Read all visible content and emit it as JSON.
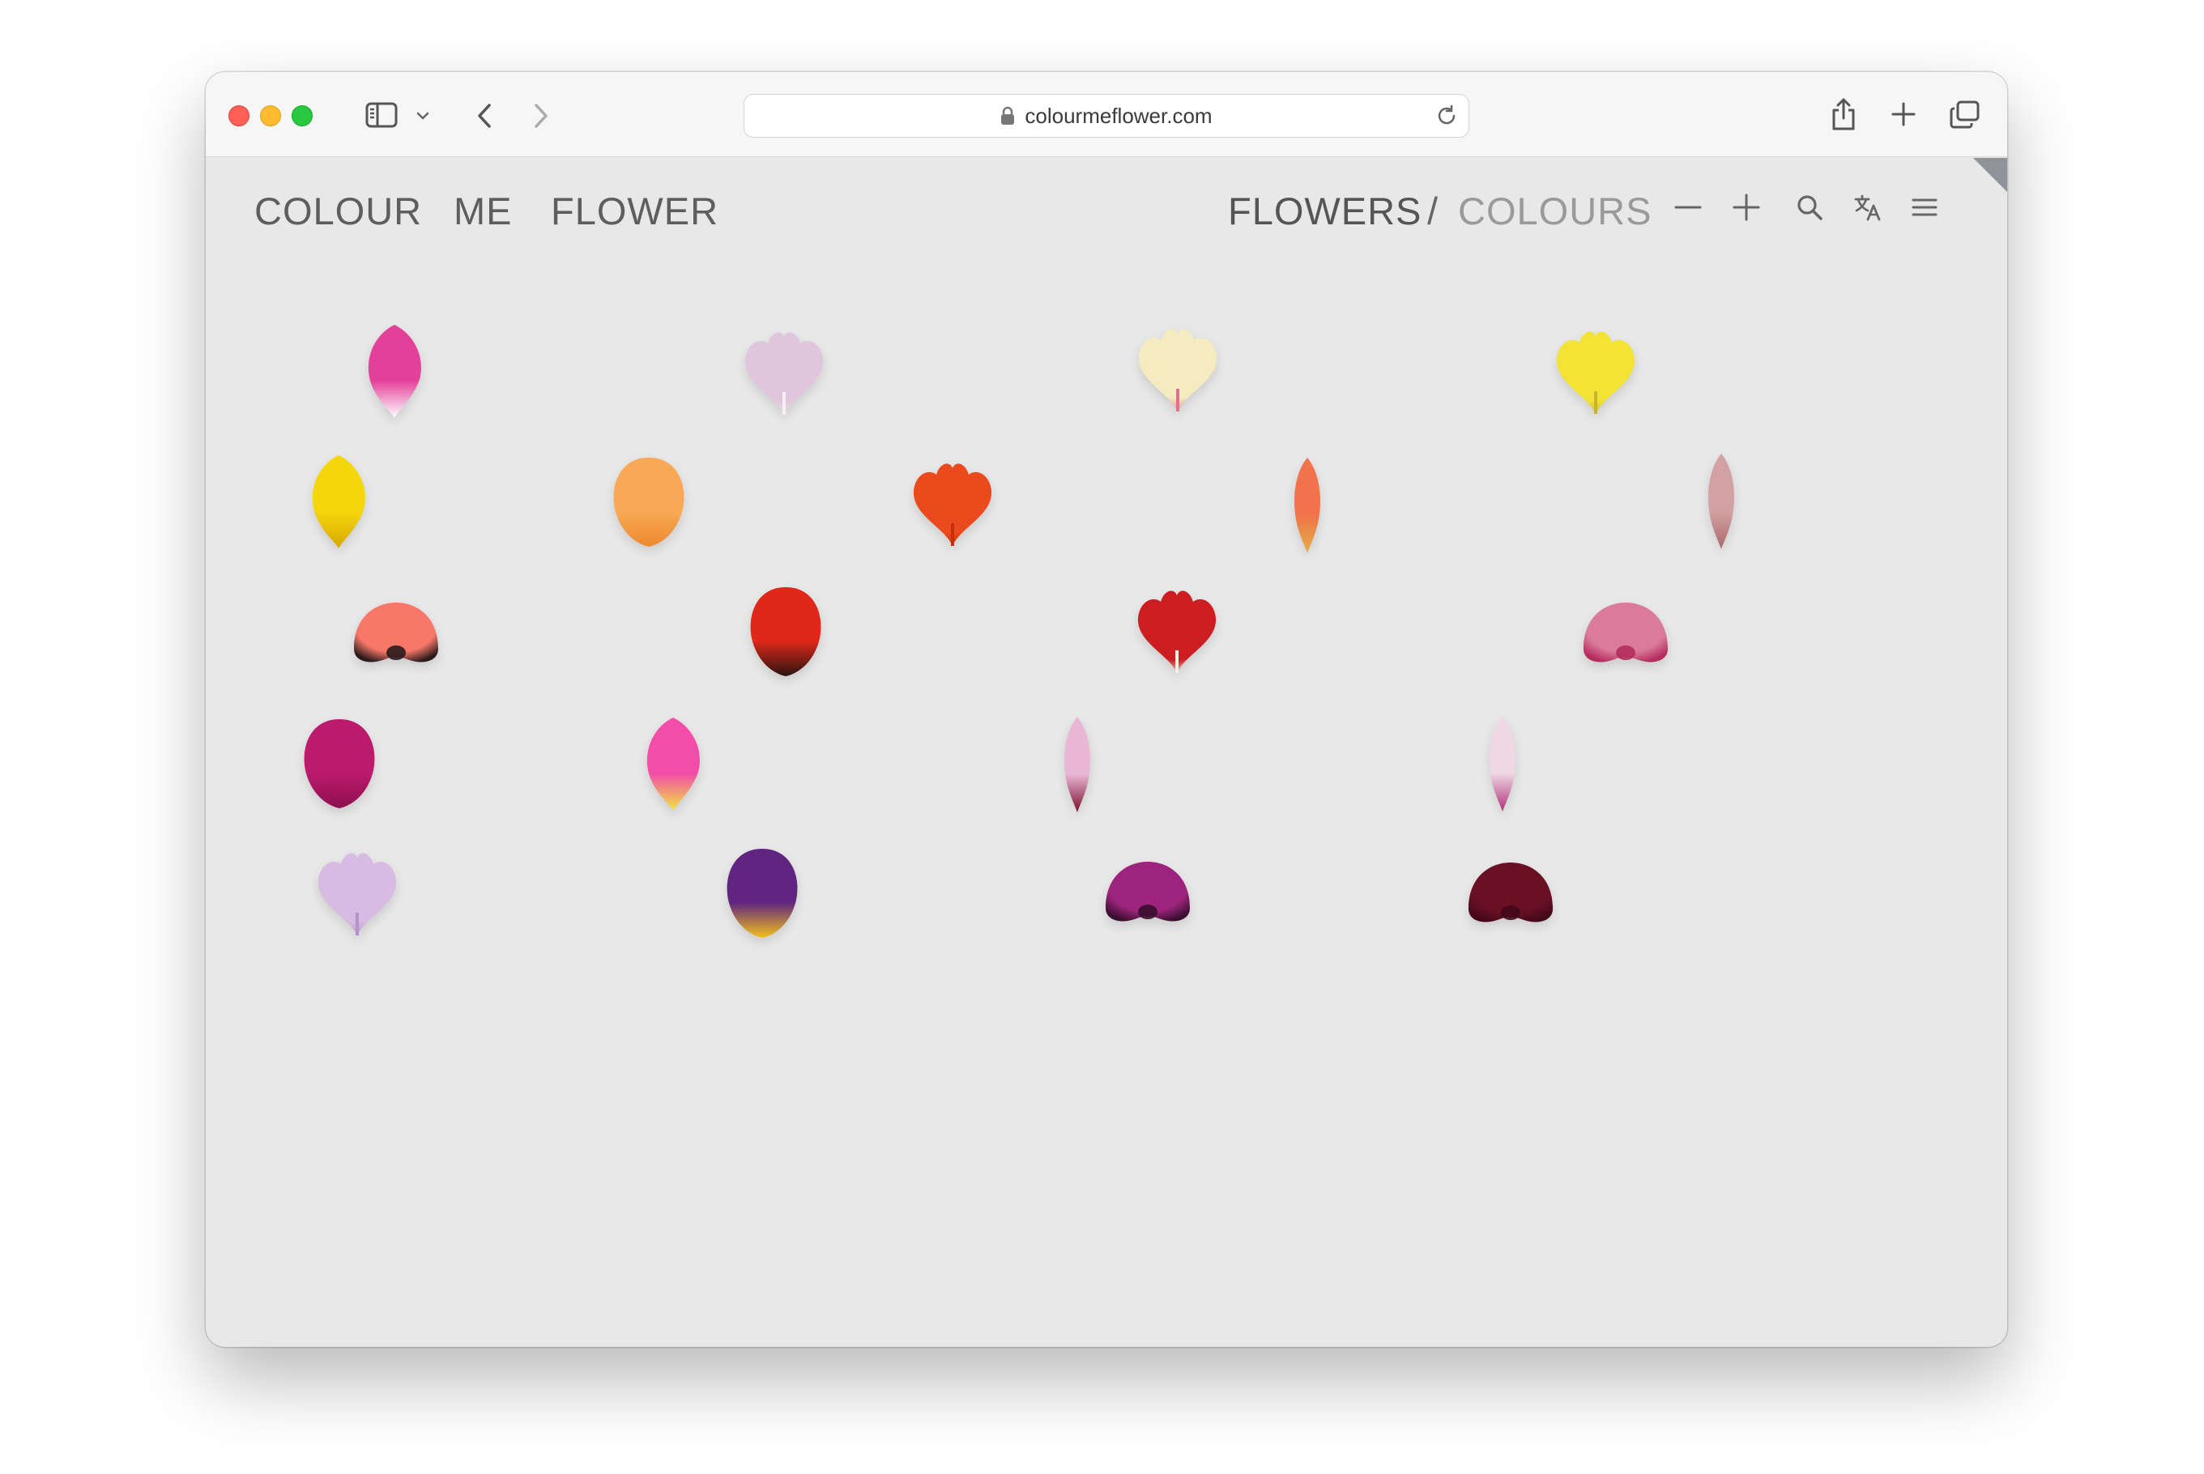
{
  "browser": {
    "url": "colourmeflower.com"
  },
  "site": {
    "logo_words": [
      "COLOUR",
      "ME",
      "FLOWER"
    ],
    "nav": {
      "flowers": "FLOWERS",
      "separator": "/",
      "colours": "COLOURS"
    },
    "icons": [
      "minus-icon",
      "plus-icon",
      "search-icon",
      "translate-icon",
      "menu-icon"
    ]
  },
  "colors": {
    "page_background": "#e8e8e8",
    "logo_text": "#5e5e5e",
    "nav_active": "#555555",
    "nav_inactive": "#9a9a9a",
    "corner_tab": "#8e9499"
  },
  "petals": [
    {
      "name": "pink-white-petal",
      "shape": "teardrop",
      "c1": "#e3409a",
      "c2": "#ffffff"
    },
    {
      "name": "lilac-fringed-petal",
      "shape": "fan",
      "c1": "#e0c6dc",
      "c2": "#f6eef3"
    },
    {
      "name": "cream-carnation-petal",
      "shape": "fan",
      "c1": "#f4ebc0",
      "c2": "#e86c8d"
    },
    {
      "name": "yellow-ruffled-petal",
      "shape": "fan",
      "c1": "#f2e334",
      "c2": "#c9b42d"
    },
    {
      "name": "yellow-petal",
      "shape": "teardrop",
      "c1": "#f5d60c",
      "c2": "#d7a800"
    },
    {
      "name": "orange-petal",
      "shape": "round",
      "c1": "#f9a955",
      "c2": "#ed8a30"
    },
    {
      "name": "red-orange-petal",
      "shape": "fan",
      "c1": "#eb4a1c",
      "c2": "#c62f0d"
    },
    {
      "name": "stamen-petal",
      "shape": "slim",
      "c1": "#f0734b",
      "c2": "#e3b044"
    },
    {
      "name": "dusty-pink-petal",
      "shape": "slim",
      "c1": "#d3a1a3",
      "c2": "#a9696c"
    },
    {
      "name": "coral-poppy-petal",
      "shape": "dome",
      "c1": "#f77869",
      "c2": "#2b1a1c"
    },
    {
      "name": "red-tulip-petal",
      "shape": "round",
      "c1": "#e0281a",
      "c2": "#2a1410"
    },
    {
      "name": "red-fringed-petal",
      "shape": "fan",
      "c1": "#cc1d20",
      "c2": "#f6eee4"
    },
    {
      "name": "pink-poppy-petal",
      "shape": "dome",
      "c1": "#da7b9c",
      "c2": "#b42c5c"
    },
    {
      "name": "magenta-petal",
      "shape": "round",
      "c1": "#bc1a6c",
      "c2": "#8c0f4f"
    },
    {
      "name": "pink-yellow-petal",
      "shape": "teardrop",
      "c1": "#f24da8",
      "c2": "#f2e640"
    },
    {
      "name": "pink-maroon-petal",
      "shape": "slim",
      "c1": "#e9b7d6",
      "c2": "#7a0e2b"
    },
    {
      "name": "spotted-petal",
      "shape": "slim",
      "c1": "#f0d7e4",
      "c2": "#b02e79"
    },
    {
      "name": "lavender-star-petal",
      "shape": "fan",
      "c1": "#d7bbe2",
      "c2": "#b593c6"
    },
    {
      "name": "purple-yellow-petal",
      "shape": "round",
      "c1": "#5f2580",
      "c2": "#f2c01a"
    },
    {
      "name": "violet-pansy-petal",
      "shape": "dome",
      "c1": "#9c247c",
      "c2": "#3a0e2e"
    },
    {
      "name": "dark-wine-petal",
      "shape": "dome",
      "c1": "#6a1024",
      "c2": "#43081a"
    }
  ]
}
